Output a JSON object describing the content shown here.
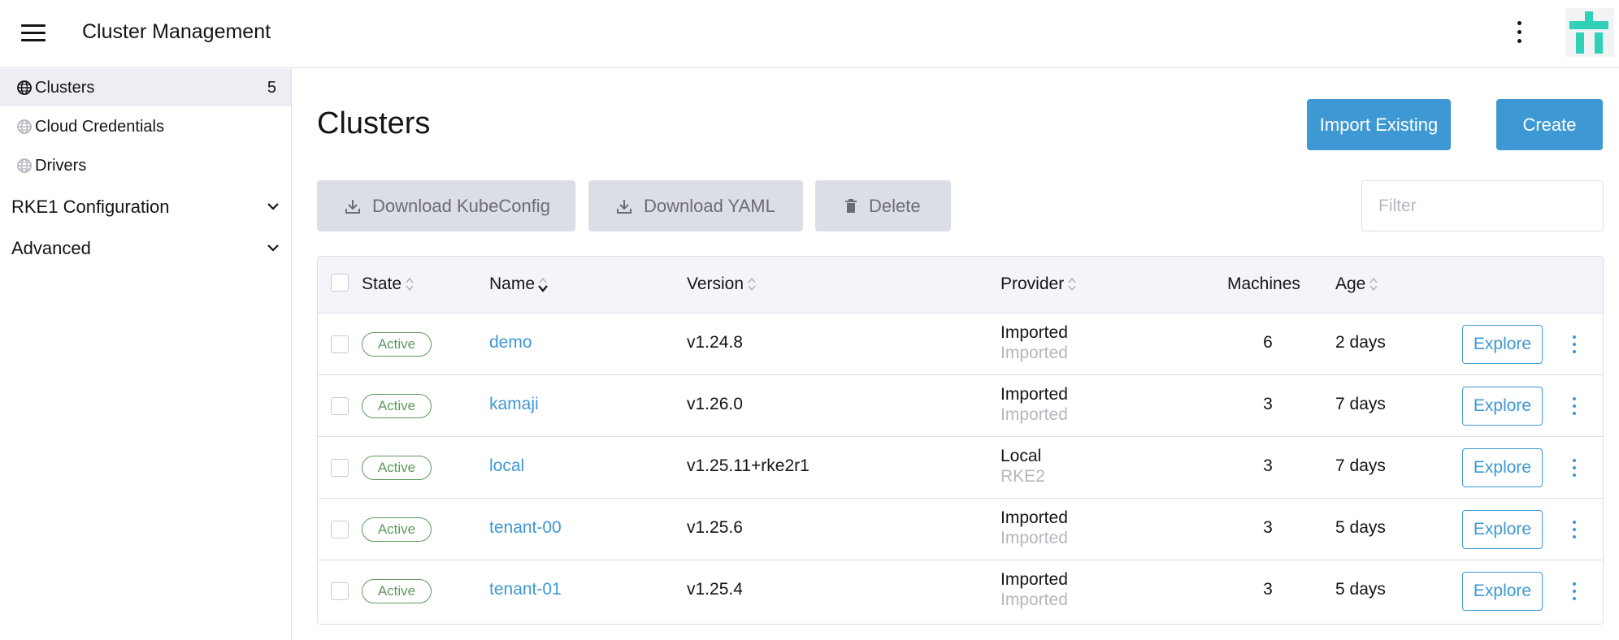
{
  "header": {
    "title": "Cluster Management"
  },
  "sidebar": {
    "items": [
      {
        "label": "Clusters",
        "count": "5",
        "icon": "globe-icon",
        "active": true
      },
      {
        "label": "Cloud Credentials",
        "icon": "globe-icon",
        "active": false
      },
      {
        "label": "Drivers",
        "icon": "globe-icon",
        "active": false
      }
    ],
    "groups": [
      {
        "label": "RKE1 Configuration",
        "icon": "chevron-down-icon"
      },
      {
        "label": "Advanced",
        "icon": "chevron-down-icon"
      }
    ]
  },
  "main": {
    "title": "Clusters",
    "import_label": "Import Existing",
    "create_label": "Create",
    "download_kubeconfig_label": "Download KubeConfig",
    "download_yaml_label": "Download YAML",
    "delete_label": "Delete",
    "filter_placeholder": "Filter"
  },
  "table": {
    "columns": {
      "state": "State",
      "name": "Name",
      "version": "Version",
      "provider": "Provider",
      "machines": "Machines",
      "age": "Age"
    },
    "rows": [
      {
        "state": "Active",
        "name": "demo",
        "version": "v1.24.8",
        "provider": "Imported",
        "provider_sub": "Imported",
        "machines": "6",
        "age": "2 days",
        "action": "Explore"
      },
      {
        "state": "Active",
        "name": "kamaji",
        "version": "v1.26.0",
        "provider": "Imported",
        "provider_sub": "Imported",
        "machines": "3",
        "age": "7 days",
        "action": "Explore"
      },
      {
        "state": "Active",
        "name": "local",
        "version": "v1.25.11+rke2r1",
        "provider": "Local",
        "provider_sub": "RKE2",
        "machines": "3",
        "age": "7 days",
        "action": "Explore"
      },
      {
        "state": "Active",
        "name": "tenant-00",
        "version": "v1.25.6",
        "provider": "Imported",
        "provider_sub": "Imported",
        "machines": "3",
        "age": "5 days",
        "action": "Explore"
      },
      {
        "state": "Active",
        "name": "tenant-01",
        "version": "v1.25.4",
        "provider": "Imported",
        "provider_sub": "Imported",
        "machines": "3",
        "age": "5 days",
        "action": "Explore"
      }
    ]
  },
  "colors": {
    "accent": "#3d98d3",
    "active_state": "#5d995d",
    "logo": "#30d1b6",
    "muted_text": "#b6b6bf"
  }
}
